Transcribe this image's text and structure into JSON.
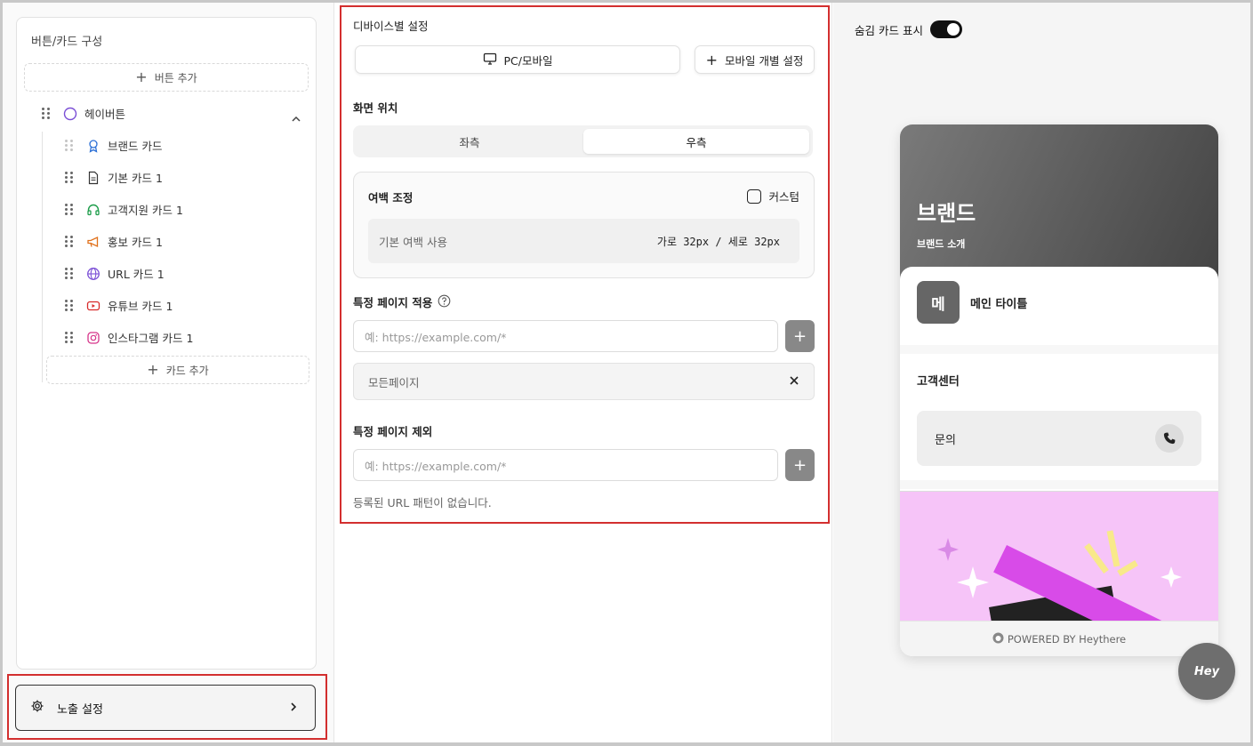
{
  "structure": {
    "title": "버튼/카드 구성",
    "add_button_label": "버튼 추가",
    "hey_button_label": "헤이버튼",
    "cards": [
      {
        "label": "브랜드 카드",
        "icon": "ribbon-icon"
      },
      {
        "label": "기본 카드 1",
        "icon": "document-icon"
      },
      {
        "label": "고객지원 카드 1",
        "icon": "headset-icon"
      },
      {
        "label": "홍보 카드 1",
        "icon": "megaphone-icon"
      },
      {
        "label": "URL 카드 1",
        "icon": "globe-icon"
      },
      {
        "label": "유튜브 카드 1",
        "icon": "youtube-icon"
      },
      {
        "label": "인스타그램 카드 1",
        "icon": "instagram-icon"
      }
    ],
    "add_card_label": "카드 추가"
  },
  "expose": {
    "label": "노출 설정"
  },
  "settings": {
    "device_title": "디바이스별 설정",
    "device_pc_mobile": "PC/모바일",
    "device_mobile_individual": "모바일 개별 설정",
    "position_title": "화면 위치",
    "position_left": "좌측",
    "position_right": "우측",
    "position_selected": "우측",
    "margin_title": "여백 조정",
    "margin_custom": "커스텀",
    "margin_default_label": "기본 여백 사용",
    "margin_default_value": "가로 32px / 세로 32px",
    "include_title": "특정 페이지 적용",
    "include_placeholder": "예: https://example.com/*",
    "include_tag": "모든페이지",
    "exclude_title": "특정 페이지 제외",
    "exclude_placeholder": "예: https://example.com/*",
    "exclude_empty": "등록된 URL 패턴이 없습니다."
  },
  "preview": {
    "hidden_cards_label": "숨김 카드 표시",
    "hidden_cards_on": true,
    "brand_name": "브랜드",
    "brand_sub": "브랜드 소개",
    "avatar_letter": "메",
    "main_title": "메인 타이틀",
    "cs_title": "고객센터",
    "cs_item": "문의",
    "footer": "POWERED BY Heythere",
    "fab_label": "Hey"
  },
  "colors": {
    "highlight_red": "#d32f2f",
    "promo_bg": "#f6c4f8"
  }
}
